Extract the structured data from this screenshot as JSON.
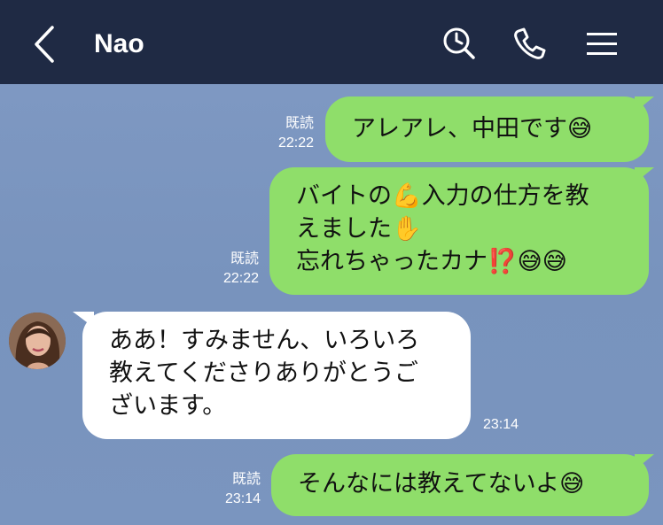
{
  "header": {
    "title": "Nao",
    "icons": [
      "back-chevron-icon",
      "search-clock-icon",
      "phone-icon",
      "menu-icon"
    ]
  },
  "messages": [
    {
      "direction": "out",
      "lines": [
        "アレアレ、中田です😅"
      ],
      "read_label": "既読",
      "time": "22:22"
    },
    {
      "direction": "out",
      "lines": [
        "バイトの💪入力の仕方を教",
        "えました✋",
        "忘れちゃったカナ⁉️😅😅"
      ],
      "read_label": "既読",
      "time": "22:22"
    },
    {
      "direction": "in",
      "lines": [
        "ああ！すみません、いろいろ",
        "教えてくださりありがとうご",
        "ざいます。"
      ],
      "time": "23:14"
    },
    {
      "direction": "out",
      "lines": [
        "そんなには教えてないよ😅"
      ],
      "read_label": "既読",
      "time": "23:14"
    }
  ],
  "colors": {
    "header_bg": "#1f2a44",
    "chat_bg": "#7b95bf",
    "outgoing_bubble": "#8fde6a",
    "incoming_bubble": "#ffffff"
  }
}
